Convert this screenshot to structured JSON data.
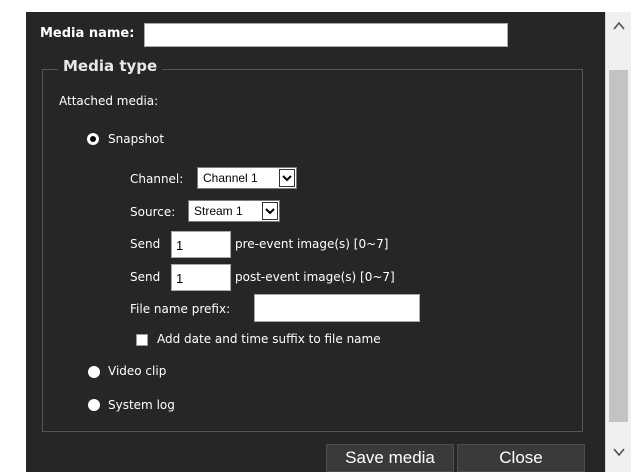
{
  "form": {
    "media_name_label": "Media name:",
    "media_name_value": "",
    "media_type_legend": "Media type",
    "attached_media_label": "Attached media:"
  },
  "options": {
    "snapshot": "Snapshot",
    "video_clip": "Video clip",
    "system_log": "System log",
    "selected": "snapshot"
  },
  "snapshot": {
    "channel_label": "Channel:",
    "channel_value": "Channel 1",
    "source_label": "Source:",
    "source_value": "Stream 1",
    "send_label": "Send",
    "pre_event_value": "1",
    "pre_event_text": "pre-event image(s) [0~7]",
    "post_event_value": "1",
    "post_event_text": "post-event image(s) [0~7]",
    "file_prefix_label": "File name prefix:",
    "file_prefix_value": "",
    "date_suffix_label": "Add date and time suffix to file name",
    "date_suffix_checked": false
  },
  "buttons": {
    "save": "Save media",
    "close": "Close"
  },
  "icons": {
    "scroll_up": "chevron-up-icon",
    "scroll_down": "chevron-down-icon",
    "select_arrow": "chevron-down-icon"
  }
}
